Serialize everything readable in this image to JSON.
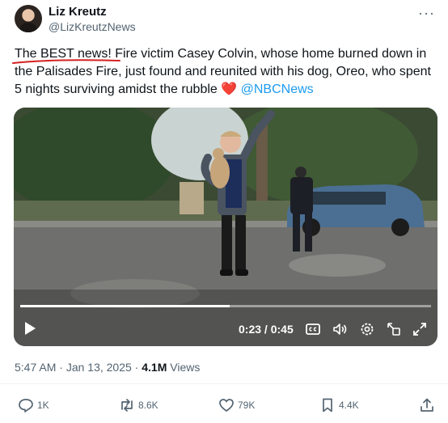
{
  "author": {
    "name": "Liz Kreutz",
    "handle": "@LizKreutzNews"
  },
  "more_icon": "more-options-icon",
  "tweet": {
    "text_part1": "The BEST news! Fire victim Casey Colvin, whose home burned down in the Palisades Fire, just found and reunited with his dog, Oreo, who spent 5 nights surviving amidst the rubble ",
    "heart": "❤️",
    "mention": "@NBCNews"
  },
  "video": {
    "current_time": "0:23",
    "separator": " / ",
    "duration": "0:45",
    "progress_fraction": 0.51,
    "icons": [
      "play-icon",
      "captions-icon",
      "volume-icon",
      "settings-icon",
      "pip-icon",
      "fullscreen-icon"
    ]
  },
  "meta": {
    "time": "5:47 AM",
    "dot": " · ",
    "date": "Jan 13, 2025",
    "views_count": "4.1M",
    "views_label": " Views"
  },
  "actions": {
    "replies": "1K",
    "reposts": "8.6K",
    "likes": "79K",
    "bookmarks": "4.4K"
  },
  "colors": {
    "link": "#1d9bf0",
    "text": "#0f1419",
    "muted": "#536471",
    "annotation_red": "#d42020"
  }
}
